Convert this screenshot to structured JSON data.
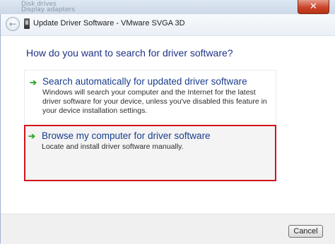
{
  "background": {
    "faint_items": [
      "Disk drives",
      "Display adapters"
    ]
  },
  "window": {
    "close_label": "✕",
    "title": "Update Driver Software - VMware SVGA 3D",
    "back_glyph": "←"
  },
  "main": {
    "heading": "How do you want to search for driver software?",
    "options": [
      {
        "arrow": "➔",
        "title": "Search automatically for updated driver software",
        "description": "Windows will search your computer and the Internet for the latest driver software for your device, unless you've disabled this feature in your device installation settings."
      },
      {
        "arrow": "➔",
        "title": "Browse my computer for driver software",
        "description": "Locate and install driver software manually."
      }
    ]
  },
  "footer": {
    "cancel_label": "Cancel"
  },
  "colors": {
    "highlight_border": "#d3131b",
    "link_title": "#1a3d8c",
    "heading": "#1e3287",
    "arrow": "#2ea82a"
  },
  "icons": {
    "back": "back-arrow-icon",
    "device": "device-icon",
    "option_arrow": "green-arrow-icon"
  }
}
